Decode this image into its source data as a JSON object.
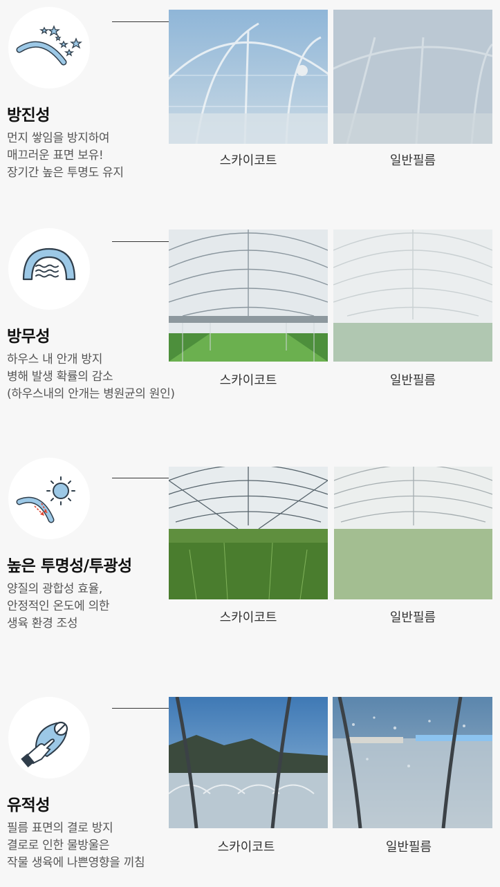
{
  "features": [
    {
      "title": "방진성",
      "desc": [
        "먼지 쌓임을 방지하여",
        "매끄러운 표면 보유!",
        "장기간 높은 투명도 유지"
      ],
      "icon": "dust-stars-icon",
      "left_caption": "스카이코트",
      "right_caption": "일반필름"
    },
    {
      "title": "방무성",
      "desc": [
        "하우스 내 안개 방지",
        "병해 발생 확률의 감소",
        "(하우스내의 안개는 병원균의 원인)"
      ],
      "icon": "fog-waves-icon",
      "left_caption": "스카이코트",
      "right_caption": "일반필름"
    },
    {
      "title": "높은 투명성/투광성",
      "desc": [
        "양질의 광합성 효율,",
        "안정적인 온도에 의한",
        "생육 환경 조성"
      ],
      "icon": "sun-light-icon",
      "left_caption": "스카이코트",
      "right_caption": "일반필름"
    },
    {
      "title": "유적성",
      "desc": [
        "필름 표면의 결로 방지",
        "결로로 인한 물방울은",
        "작물 생육에 나쁜영향을 끼침"
      ],
      "icon": "no-drip-hand-icon",
      "left_caption": "스카이코트",
      "right_caption": "일반필름"
    }
  ],
  "colors": {
    "background": "#f7f7f7",
    "icon_blue": "#9cc8e6",
    "icon_stroke": "#2f3d4a"
  }
}
